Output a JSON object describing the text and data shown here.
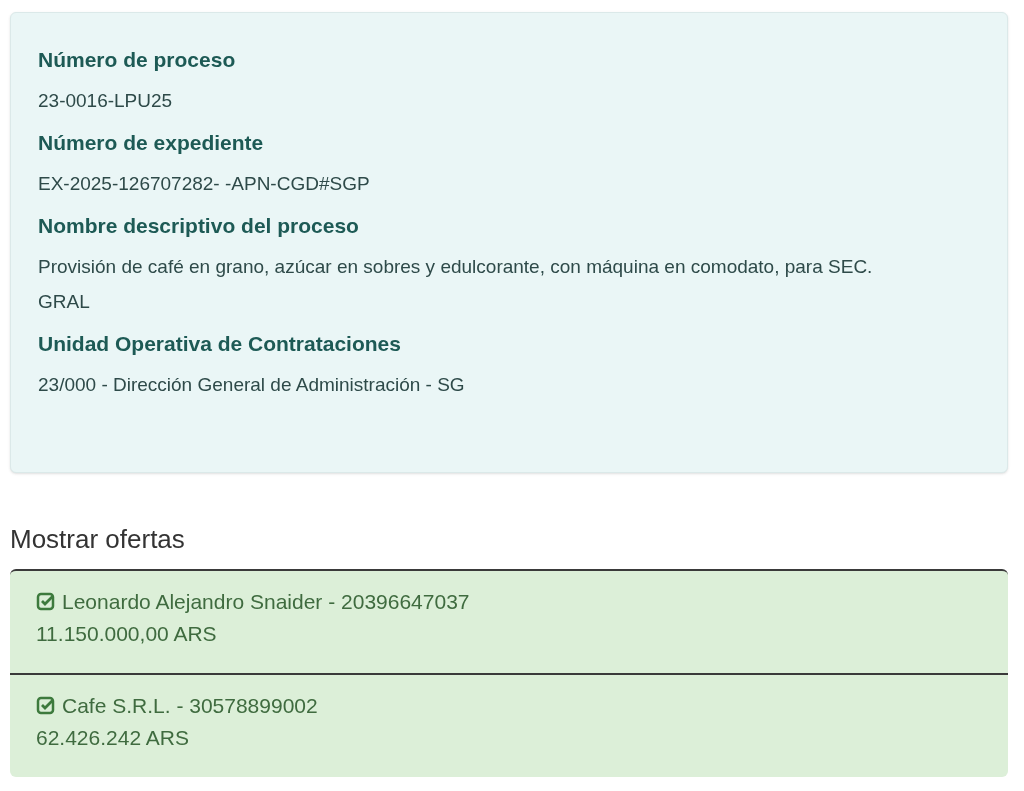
{
  "process_card": {
    "fields": [
      {
        "label": "Número de proceso",
        "value": "23-0016-LPU25"
      },
      {
        "label": "Número de expediente",
        "value": "EX-2025-126707282-   -APN-CGD#SGP"
      },
      {
        "label": "Nombre descriptivo del proceso",
        "value": "Provisión de café en grano, azúcar en sobres y edulcorante, con máquina en comodato, para SEC. GRAL"
      },
      {
        "label": "Unidad Operativa de Contrataciones",
        "value": "23/000 - Dirección General de Administración - SG"
      }
    ]
  },
  "offers": {
    "title": "Mostrar ofertas",
    "items": [
      {
        "checked": true,
        "name": "Leonardo Alejandro Snaider - 20396647037",
        "amount": "11.150.000,00 ARS"
      },
      {
        "checked": true,
        "name": "Cafe S.R.L. - 30578899002",
        "amount": "62.426.242 ARS"
      }
    ]
  }
}
